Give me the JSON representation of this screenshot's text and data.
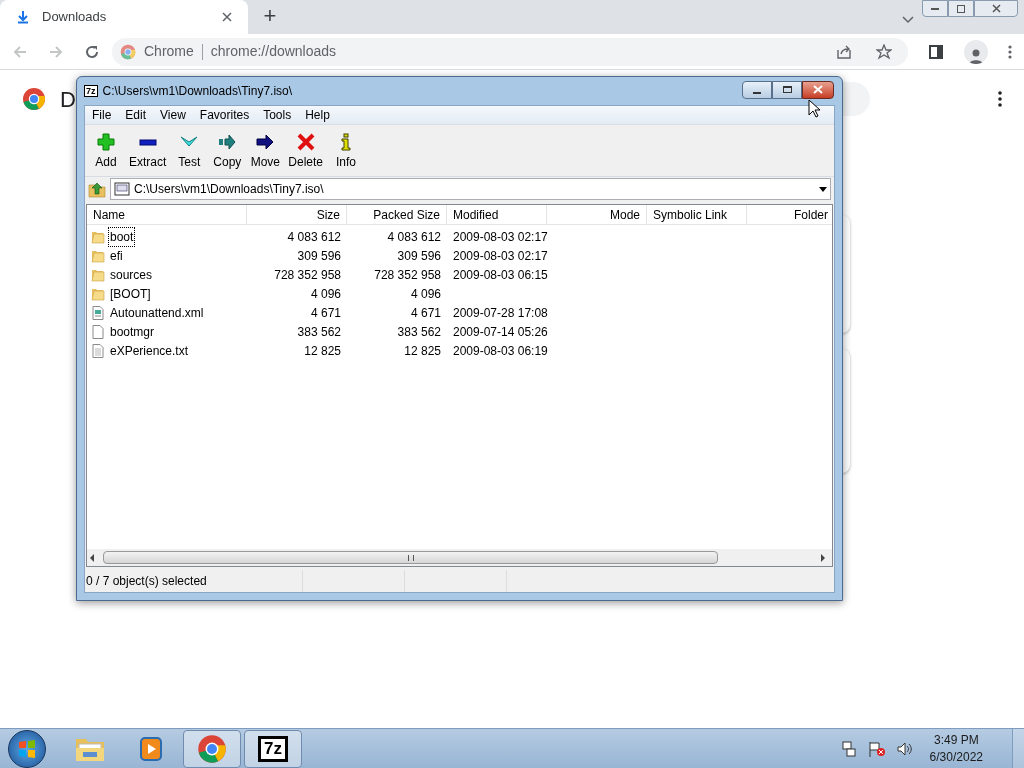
{
  "browser": {
    "tab": {
      "title": "Downloads",
      "selected": true
    },
    "new_tab": "+",
    "omnibox": {
      "site": "Chrome",
      "url": "chrome://downloads"
    },
    "page": {
      "heading": "D"
    }
  },
  "archive_window": {
    "app_icon": "7z",
    "title": "C:\\Users\\vm1\\Downloads\\Tiny7.iso\\",
    "menu": [
      "File",
      "Edit",
      "View",
      "Favorites",
      "Tools",
      "Help"
    ],
    "toolbar": [
      {
        "kind": "add",
        "label": "Add"
      },
      {
        "kind": "extract",
        "label": "Extract"
      },
      {
        "kind": "test",
        "label": "Test"
      },
      {
        "kind": "copy",
        "label": "Copy"
      },
      {
        "kind": "move",
        "label": "Move"
      },
      {
        "kind": "delete",
        "label": "Delete"
      },
      {
        "kind": "info",
        "label": "Info"
      }
    ],
    "path": "C:\\Users\\vm1\\Downloads\\Tiny7.iso\\",
    "columns": [
      {
        "label": "Name",
        "kind": "text"
      },
      {
        "label": "Size",
        "kind": "number"
      },
      {
        "label": "Packed Size",
        "kind": "number"
      },
      {
        "label": "Modified",
        "kind": "text"
      },
      {
        "label": "Mode",
        "kind": "number"
      },
      {
        "label": "Symbolic Link",
        "kind": "text"
      },
      {
        "label": "Folder",
        "kind": "number"
      }
    ],
    "rows": [
      {
        "kind": "folder",
        "name": "boot",
        "size": "4 083 612",
        "packed_size": "4 083 612",
        "modified": "2009-08-03 02:17",
        "focused": true
      },
      {
        "kind": "folder",
        "name": "efi",
        "size": "309 596",
        "packed_size": "309 596",
        "modified": "2009-08-03 02:17",
        "focused": false
      },
      {
        "kind": "folder",
        "name": "sources",
        "size": "728 352 958",
        "packed_size": "728 352 958",
        "modified": "2009-08-03 06:15",
        "focused": false
      },
      {
        "kind": "folder",
        "name": "[BOOT]",
        "size": "4 096",
        "packed_size": "4 096",
        "focused": false
      },
      {
        "kind": "xml",
        "name": "Autounattend.xml",
        "size": "4 671",
        "packed_size": "4 671",
        "modified": "2009-07-28 17:08",
        "focused": false
      },
      {
        "kind": "file",
        "name": "bootmgr",
        "size": "383 562",
        "packed_size": "383 562",
        "modified": "2009-07-14 05:26",
        "focused": false
      },
      {
        "kind": "text",
        "name": "eXPerience.txt",
        "size": "12 825",
        "packed_size": "12 825",
        "modified": "2009-08-03 06:19",
        "focused": false
      }
    ],
    "status": "0 / 7 object(s) selected"
  },
  "taskbar": {
    "items": [
      {
        "kind": "explorer",
        "active": false
      },
      {
        "kind": "media",
        "active": false
      },
      {
        "kind": "chrome",
        "active": true
      },
      {
        "kind": "sevenzip",
        "label": "7z",
        "active": true
      }
    ],
    "time": "3:49 PM",
    "date": "6/30/2022"
  }
}
